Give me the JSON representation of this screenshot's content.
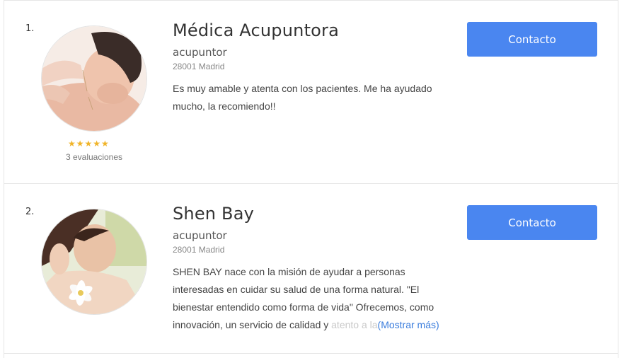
{
  "results": [
    {
      "rank": "1.",
      "name": "Médica Acupuntora",
      "category": "acupuntor",
      "location": "28001 Madrid",
      "description": "Es muy amable y atenta con los pacientes. Me ha ayudado mucho, la recomiendo!!",
      "rating": 5,
      "rating_stars": "★★★★★",
      "reviews": "3 evaluaciones",
      "contact_label": "Contacto"
    },
    {
      "rank": "2.",
      "name": "Shen Bay",
      "category": "acupuntor",
      "location": "28001 Madrid",
      "description": "SHEN BAY nace con la misión de ayudar a personas interesadas en cuidar su salud de una forma natural. \"El bienestar entendido como forma de vida\" Ofrecemos, como innovación, un servicio de calidad y",
      "description_fade": " atento a la",
      "more_label": "(Mostrar más)",
      "contact_label": "Contacto"
    }
  ],
  "colors": {
    "accent": "#4a86f0",
    "star": "#f0b429",
    "link": "#3b7ddd"
  },
  "icons": {
    "rating": "star-icon"
  }
}
